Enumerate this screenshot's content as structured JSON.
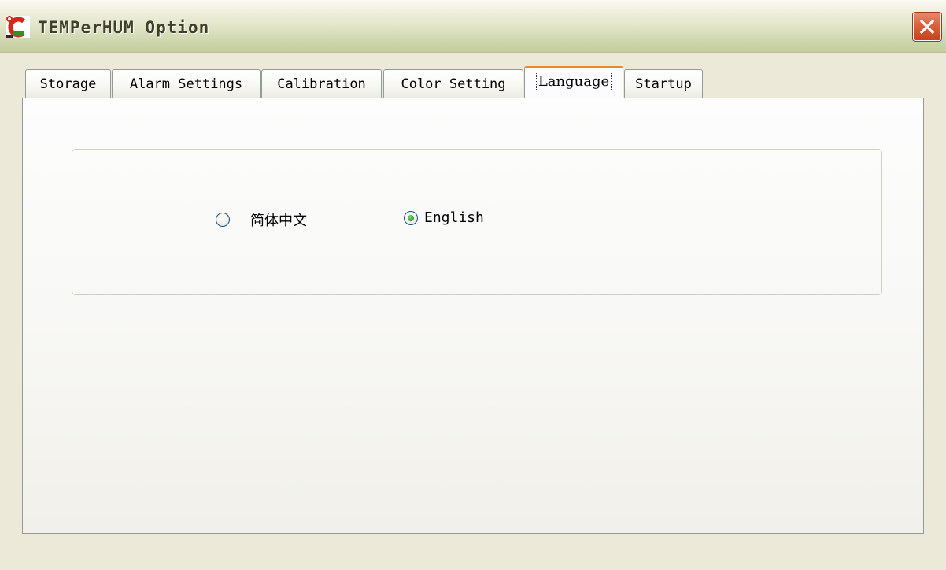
{
  "window": {
    "title": "TEMPerHUM Option",
    "colors": {
      "titlebar": "#d6dcbb",
      "close": "#d4552f",
      "tab_highlight": "#e68b2c",
      "background": "#ece9d8"
    }
  },
  "tabs": [
    {
      "label": "Storage"
    },
    {
      "label": "Alarm Settings"
    },
    {
      "label": "Calibration"
    },
    {
      "label": "Color Setting"
    },
    {
      "label": "Language",
      "selected": true
    },
    {
      "label": "Startup"
    }
  ],
  "language": {
    "options": [
      {
        "label": "简体中文",
        "checked": false
      },
      {
        "label": "English",
        "checked": true
      }
    ]
  },
  "icons": {
    "app": "temperature-app-icon",
    "close": "close-icon"
  }
}
